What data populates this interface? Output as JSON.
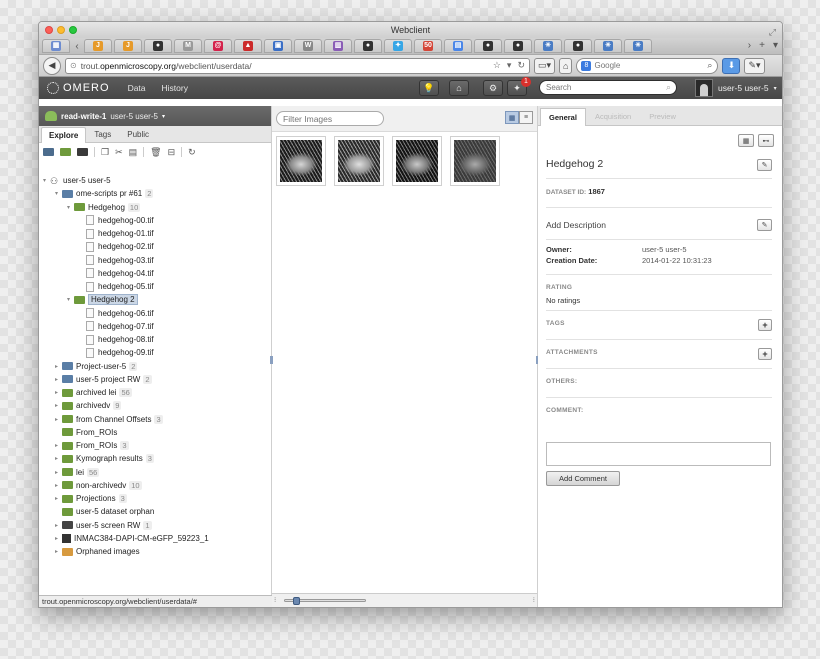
{
  "window": {
    "title": "Webclient"
  },
  "browser_tabs": [
    {
      "icon": "grid-app-icon",
      "color": "#6d8cd0",
      "glyph": "▦"
    },
    {
      "icon": "j-icon",
      "color": "#e69a2a",
      "glyph": "J"
    },
    {
      "icon": "j-icon",
      "color": "#e69a2a",
      "glyph": "J"
    },
    {
      "icon": "github-icon",
      "color": "#333333",
      "glyph": "●"
    },
    {
      "icon": "m-icon",
      "color": "#9a9a9a",
      "glyph": "M"
    },
    {
      "icon": "debian-icon",
      "color": "#d4234c",
      "glyph": "@"
    },
    {
      "icon": "redhat-icon",
      "color": "#cc2a2a",
      "glyph": "▲"
    },
    {
      "icon": "trello-icon",
      "color": "#3b6fc6",
      "glyph": "▣"
    },
    {
      "icon": "wikipedia-icon",
      "color": "#888888",
      "glyph": "W"
    },
    {
      "icon": "trello-icon",
      "color": "#8a5db6",
      "glyph": "▥"
    },
    {
      "icon": "github-icon",
      "color": "#333333",
      "glyph": "●"
    },
    {
      "icon": "twitter-icon",
      "color": "#36a6e6",
      "glyph": "✦"
    },
    {
      "icon": "gmail-icon",
      "color": "#d44638",
      "glyph": "50"
    },
    {
      "icon": "docs-icon",
      "color": "#4a86e8",
      "glyph": "▤"
    },
    {
      "icon": "github-icon",
      "color": "#333333",
      "glyph": "●"
    },
    {
      "icon": "github-icon",
      "color": "#333333",
      "glyph": "●"
    },
    {
      "icon": "omero-icon",
      "color": "#4a7cc4",
      "glyph": "✳"
    },
    {
      "icon": "github-icon",
      "color": "#333333",
      "glyph": "●"
    },
    {
      "icon": "omero-icon",
      "color": "#4a7cc4",
      "glyph": "✳"
    },
    {
      "icon": "omero-icon",
      "color": "#4a7cc4",
      "glyph": "✳"
    }
  ],
  "url": {
    "prefix": "trout.",
    "host": "openmicroscopy.org",
    "path": "/webclient/userdata/"
  },
  "google_search": {
    "placeholder": "Google"
  },
  "omero": {
    "logo": "OMERO",
    "nav": [
      "Data",
      "History"
    ],
    "notification_count": "1",
    "search_placeholder": "Search",
    "user": "user-5 user-5"
  },
  "group": {
    "name": "read-write-1",
    "user": "user-5 user-5"
  },
  "left_tabs": [
    "Explore",
    "Tags",
    "Public"
  ],
  "tree": [
    {
      "label": "user-5 user-5",
      "count": "",
      "type": "user",
      "indent": 0,
      "tri": "▾"
    },
    {
      "label": "ome-scripts pr #61",
      "count": "2",
      "type": "blue",
      "indent": 1,
      "tri": "▾"
    },
    {
      "label": "Hedgehog",
      "count": "10",
      "type": "green",
      "indent": 2,
      "tri": "▾"
    },
    {
      "label": "hedgehog-00.tif",
      "count": "",
      "type": "file",
      "indent": 3,
      "tri": ""
    },
    {
      "label": "hedgehog-01.tif",
      "count": "",
      "type": "file",
      "indent": 3,
      "tri": ""
    },
    {
      "label": "hedgehog-02.tif",
      "count": "",
      "type": "file",
      "indent": 3,
      "tri": ""
    },
    {
      "label": "hedgehog-03.tif",
      "count": "",
      "type": "file",
      "indent": 3,
      "tri": ""
    },
    {
      "label": "hedgehog-04.tif",
      "count": "",
      "type": "file",
      "indent": 3,
      "tri": ""
    },
    {
      "label": "hedgehog-05.tif",
      "count": "",
      "type": "file",
      "indent": 3,
      "tri": ""
    },
    {
      "label": "Hedgehog 2",
      "count": "",
      "type": "green",
      "indent": 2,
      "tri": "▾",
      "selected": true
    },
    {
      "label": "hedgehog-06.tif",
      "count": "",
      "type": "file",
      "indent": 3,
      "tri": ""
    },
    {
      "label": "hedgehog-07.tif",
      "count": "",
      "type": "file",
      "indent": 3,
      "tri": ""
    },
    {
      "label": "hedgehog-08.tif",
      "count": "",
      "type": "file",
      "indent": 3,
      "tri": ""
    },
    {
      "label": "hedgehog-09.tif",
      "count": "",
      "type": "file",
      "indent": 3,
      "tri": ""
    },
    {
      "label": "Project-user-5",
      "count": "2",
      "type": "blue",
      "indent": 1,
      "tri": "▸"
    },
    {
      "label": "user-5 project RW",
      "count": "2",
      "type": "blue",
      "indent": 1,
      "tri": "▸"
    },
    {
      "label": "archived lei",
      "count": "56",
      "type": "green",
      "indent": 1,
      "tri": "▸"
    },
    {
      "label": "archivedv",
      "count": "9",
      "type": "green",
      "indent": 1,
      "tri": "▸"
    },
    {
      "label": "from Channel Offsets",
      "count": "3",
      "type": "green",
      "indent": 1,
      "tri": "▸"
    },
    {
      "label": "From_ROIs",
      "count": "",
      "type": "green",
      "indent": 1,
      "tri": ""
    },
    {
      "label": "From_ROIs",
      "count": "3",
      "type": "green",
      "indent": 1,
      "tri": "▸"
    },
    {
      "label": "Kymograph results",
      "count": "3",
      "type": "green",
      "indent": 1,
      "tri": "▸"
    },
    {
      "label": "lei",
      "count": "56",
      "type": "green",
      "indent": 1,
      "tri": "▸"
    },
    {
      "label": "non-archivedv",
      "count": "10",
      "type": "green",
      "indent": 1,
      "tri": "▸"
    },
    {
      "label": "Projections",
      "count": "3",
      "type": "green",
      "indent": 1,
      "tri": "▸"
    },
    {
      "label": "user-5 dataset orphan",
      "count": "",
      "type": "green",
      "indent": 1,
      "tri": ""
    },
    {
      "label": "user-5 screen RW",
      "count": "1",
      "type": "dark",
      "indent": 1,
      "tri": "▸"
    },
    {
      "label": "INMAC384-DAPI-CM-eGFP_59223_1",
      "count": "",
      "type": "plate",
      "indent": 1,
      "tri": "▸"
    },
    {
      "label": "Orphaned images",
      "count": "",
      "type": "orange",
      "indent": 1,
      "tri": "▸"
    }
  ],
  "status_url": "trout.openmicroscopy.org/webclient/userdata/#",
  "center": {
    "filter_placeholder": "Filter Images",
    "thumbnail_count": 4
  },
  "right": {
    "tabs": [
      "General",
      "Acquisition",
      "Preview"
    ],
    "title": "Hedgehog 2",
    "dataset_id_label": "DATASET ID:",
    "dataset_id": "1867",
    "add_description": "Add Description",
    "owner_label": "Owner:",
    "owner": "user-5 user-5",
    "creation_label": "Creation Date:",
    "creation_date": "2014-01-22 10:31:23",
    "rating_label": "RATING",
    "rating_value": "No ratings",
    "tags_label": "TAGS",
    "attachments_label": "ATTACHMENTS",
    "others_label": "OTHERS:",
    "comment_label": "COMMENT:",
    "add_comment": "Add Comment"
  }
}
